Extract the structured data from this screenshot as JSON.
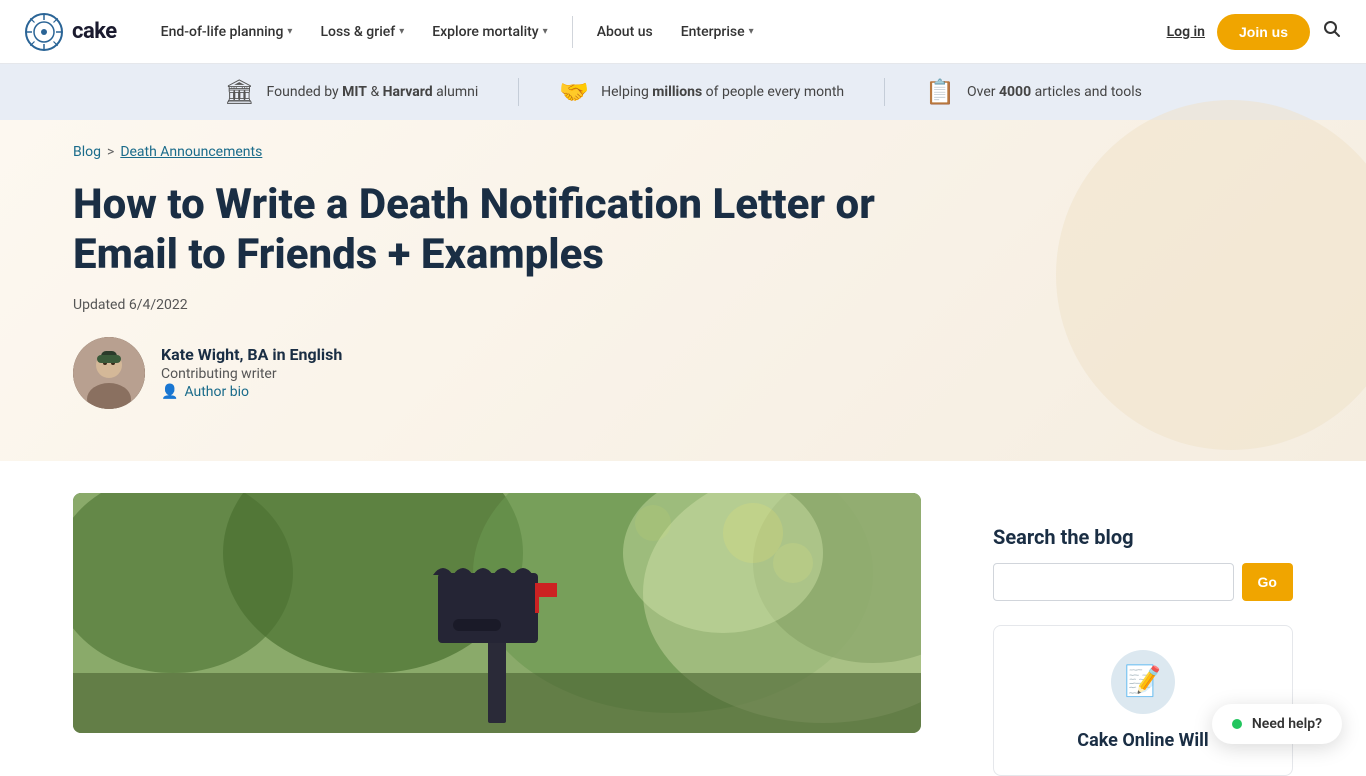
{
  "site": {
    "logo_text": "cake",
    "logo_icon": "⊙"
  },
  "nav": {
    "items": [
      {
        "label": "End-of-life planning",
        "has_dropdown": true
      },
      {
        "label": "Loss & grief",
        "has_dropdown": true
      },
      {
        "label": "Explore mortality",
        "has_dropdown": true
      },
      {
        "label": "About us",
        "has_dropdown": false
      },
      {
        "label": "Enterprise",
        "has_dropdown": true
      }
    ],
    "login_label": "Log in",
    "join_label": "Join us",
    "search_icon": "🔍"
  },
  "banner": {
    "items": [
      {
        "icon": "🏛",
        "text_pre": "Founded by ",
        "bold1": "MIT",
        "text_mid": " & ",
        "bold2": "Harvard",
        "text_post": " alumni"
      },
      {
        "icon": "🤝",
        "text_pre": "Helping ",
        "bold": "millions",
        "text_post": " of people every month"
      },
      {
        "icon": "📋",
        "text_pre": "Over ",
        "bold": "4000",
        "text_post": " articles and tools"
      }
    ]
  },
  "breadcrumb": {
    "blog_label": "Blog",
    "separator": ">",
    "current_label": "Death Announcements"
  },
  "article": {
    "title": "How to Write a Death Notification Letter or Email to Friends + Examples",
    "updated_label": "Updated 6/4/2022"
  },
  "author": {
    "name": "Kate Wight, BA in English",
    "role": "Contributing writer",
    "bio_label": "Author bio"
  },
  "sidebar": {
    "search_title": "Search the blog",
    "search_placeholder": "",
    "search_btn": "Go",
    "card_title": "Cake Online Will",
    "card_icon": "📝"
  },
  "chat": {
    "label": "Need help?"
  }
}
